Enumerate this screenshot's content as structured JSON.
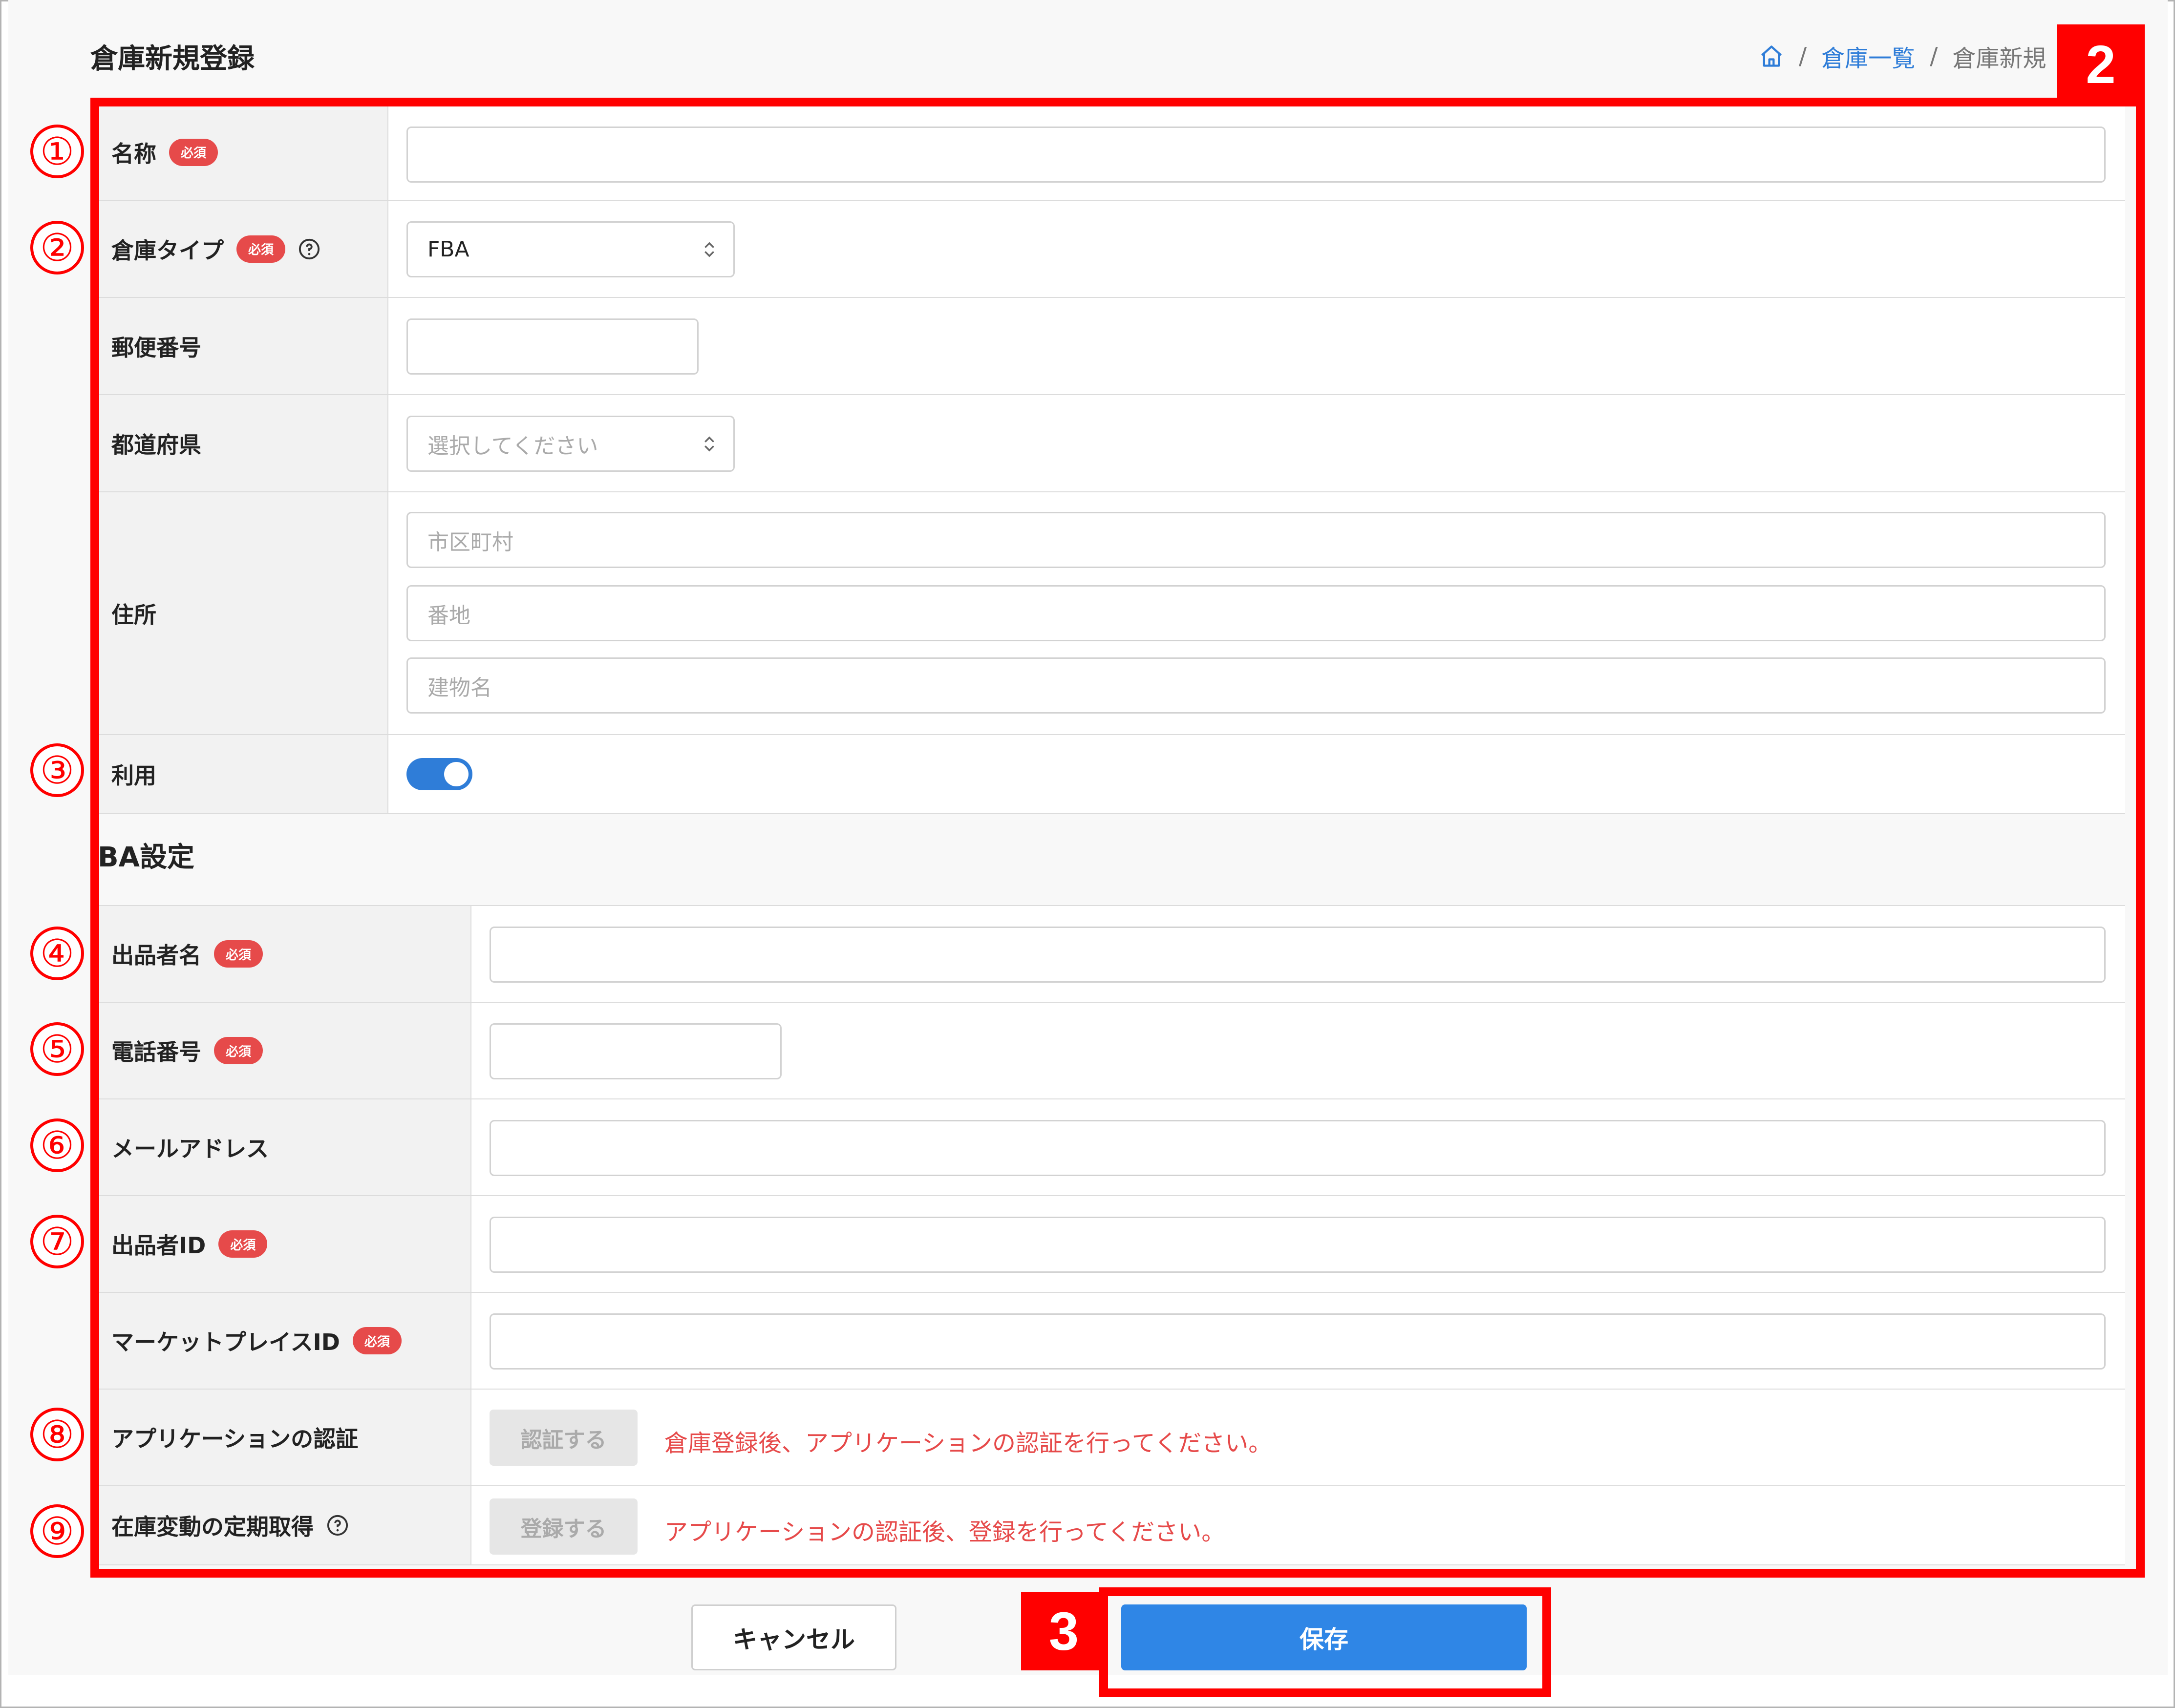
{
  "header": {
    "title": "倉庫新規登録",
    "breadcrumb": {
      "sep": "/",
      "list": "倉庫一覧",
      "current": "倉庫新規"
    }
  },
  "required_badge": "必須",
  "warehouse_form": {
    "name": {
      "label": "名称",
      "value": ""
    },
    "type": {
      "label": "倉庫タイプ",
      "value": "FBA"
    },
    "postal": {
      "label": "郵便番号",
      "value": ""
    },
    "prefecture": {
      "label": "都道府県",
      "placeholder": "選択してください"
    },
    "address": {
      "label": "住所",
      "city_placeholder": "市区町村",
      "street_placeholder": "番地",
      "building_placeholder": "建物名"
    },
    "usage": {
      "label": "利用",
      "enabled": true
    }
  },
  "fba_section": {
    "title": "BA設定",
    "seller_name": {
      "label": "出品者名",
      "value": ""
    },
    "phone": {
      "label": "電話番号",
      "value": ""
    },
    "email": {
      "label": "メールアドレス",
      "value": ""
    },
    "seller_id": {
      "label": "出品者ID",
      "value": ""
    },
    "marketplace_id": {
      "label": "マーケットプレイスID",
      "value": ""
    },
    "app_auth": {
      "label": "アプリケーションの認証",
      "button": "認証する",
      "note": "倉庫登録後、アプリケーションの認証を行ってください。"
    },
    "stock_sync": {
      "label": "在庫変動の定期取得",
      "button": "登録する",
      "note": "アプリケーションの認証後、登録を行ってください。"
    }
  },
  "actions": {
    "cancel": "キャンセル",
    "save": "保存"
  },
  "annotations": {
    "box2": "2",
    "box3": "3",
    "n1": "①",
    "n2": "②",
    "n3": "③",
    "n4": "④",
    "n5": "⑤",
    "n6": "⑥",
    "n7": "⑦",
    "n8": "⑧",
    "n9": "⑨"
  },
  "colors": {
    "accent": "#2f7dd8",
    "save_button": "#2f86e6",
    "required": "#e64a4a",
    "annotation": "#ff0000"
  }
}
